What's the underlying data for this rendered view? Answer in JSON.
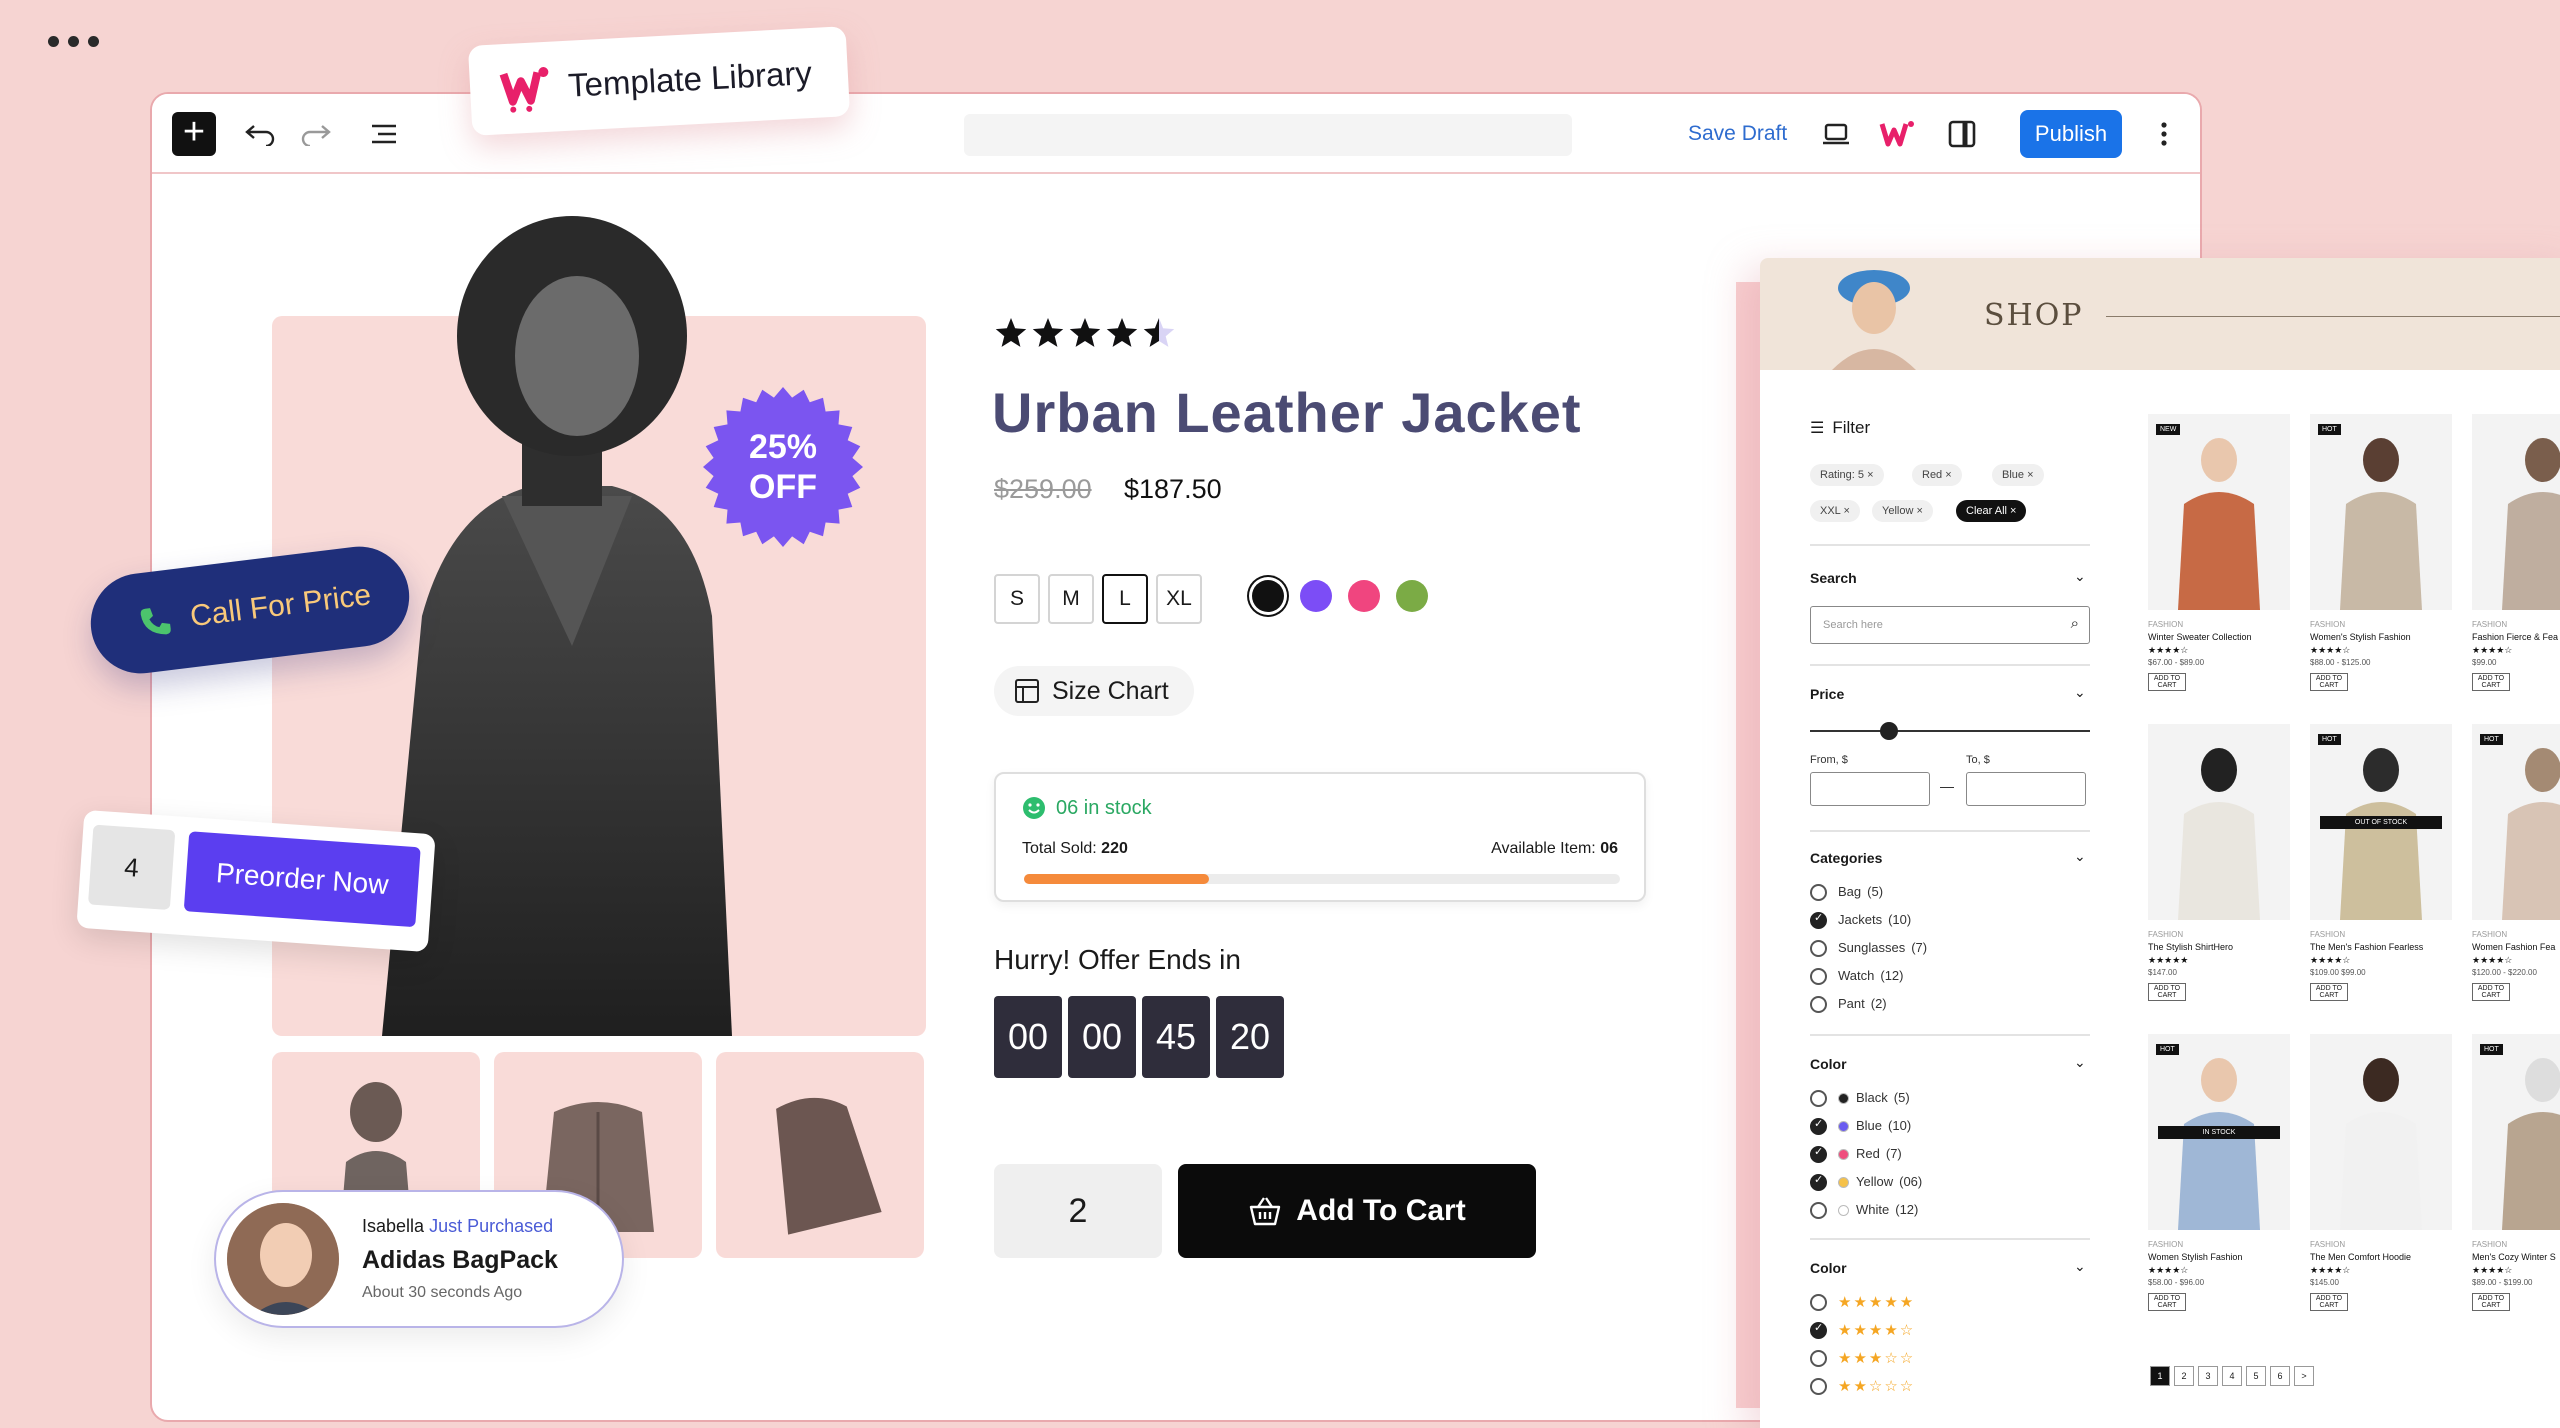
{
  "toolbar": {
    "save_draft": "Save Draft",
    "publish": "Publish"
  },
  "template_library": {
    "label": "Template Library"
  },
  "product": {
    "badge_pct": "25%",
    "badge_off": "OFF",
    "rating": 4.5,
    "title": "Urban Leather Jacket",
    "old_price": "$259.00",
    "price": "$187.50",
    "sizes": [
      "S",
      "M",
      "L",
      "XL"
    ],
    "selected_size": "L",
    "colors": [
      "#111111",
      "#7c4df6",
      "#f0457f",
      "#7bab45"
    ],
    "size_chart": "Size Chart",
    "stock_text": "06 in stock",
    "total_sold_label": "Total Sold:",
    "total_sold": "220",
    "available_label": "Available Item:",
    "available": "06",
    "stock_progress": 0.31,
    "hurry": "Hurry! Offer Ends in",
    "countdown": [
      "00",
      "00",
      "45",
      "20"
    ],
    "quantity": "2",
    "add_to_cart": "Add To Cart"
  },
  "call_for_price": "Call For Price",
  "preorder": {
    "qty": "4",
    "label": "Preorder Now"
  },
  "notification": {
    "name": "Isabella",
    "action": "Just Purchased",
    "product": "Adidas BagPack",
    "time": "About 30 seconds Ago"
  },
  "shop": {
    "title": "SHOP",
    "filter": "Filter",
    "chips": [
      "Rating: 5",
      "Red",
      "Blue",
      "XXL",
      "Yellow",
      "Clear All"
    ],
    "search_title": "Search",
    "search_placeholder": "Search here",
    "price_title": "Price",
    "from_label": "From, $",
    "to_label": "To, $",
    "categories_title": "Categories",
    "categories": [
      {
        "label": "Bag",
        "count": "(5)",
        "checked": false
      },
      {
        "label": "Jackets",
        "count": "(10)",
        "checked": true
      },
      {
        "label": "Sunglasses",
        "count": "(7)",
        "checked": false
      },
      {
        "label": "Watch",
        "count": "(12)",
        "checked": false
      },
      {
        "label": "Pant",
        "count": "(2)",
        "checked": false
      }
    ],
    "color_title": "Color",
    "colors": [
      {
        "label": "Black",
        "count": "(5)",
        "checked": false,
        "swatch": "#222222"
      },
      {
        "label": "Blue",
        "count": "(10)",
        "checked": true,
        "swatch": "#6a5cf0"
      },
      {
        "label": "Red",
        "count": "(7)",
        "checked": true,
        "swatch": "#ef4f7e"
      },
      {
        "label": "Yellow",
        "count": "(06)",
        "checked": true,
        "swatch": "#f5c149"
      },
      {
        "label": "White",
        "count": "(12)",
        "checked": false,
        "swatch": "#ffffff"
      }
    ],
    "rating_title": "Color",
    "ratings": [
      {
        "stars": 5,
        "checked": false
      },
      {
        "stars": 4,
        "checked": true
      },
      {
        "stars": 3,
        "checked": false
      },
      {
        "stars": 2,
        "checked": false
      }
    ],
    "products": [
      {
        "tag": "NEW",
        "cat": "FASHION",
        "name": "Winter Sweater Collection",
        "stars": "★★★★☆",
        "price": "$67.00 - $89.00",
        "btn": "ADD TO CART"
      },
      {
        "tag": "HOT",
        "cat": "FASHION",
        "name": "Women's Stylish Fashion",
        "stars": "★★★★☆",
        "price": "$88.00 - $125.00",
        "btn": "ADD TO CART"
      },
      {
        "tag": "",
        "cat": "FASHION",
        "name": "Fashion Fierce & Fea",
        "stars": "★★★★☆",
        "price": "$99.00",
        "btn": "ADD TO CART"
      },
      {
        "tag": "",
        "cat": "FASHION",
        "name": "The Stylish ShirtHero",
        "stars": "★★★★★",
        "price": "$147.00",
        "btn": "ADD TO CART"
      },
      {
        "tag": "HOT",
        "cat": "FASHION",
        "name": "The Men's Fashion Fearless",
        "stars": "★★★★☆",
        "price": "$109.00 $99.00",
        "btn": "ADD TO CART",
        "overlay": "OUT OF STOCK"
      },
      {
        "tag": "HOT",
        "cat": "FASHION",
        "name": "Women Fashion Fea",
        "stars": "★★★★☆",
        "price": "$120.00 - $220.00",
        "btn": "ADD TO CART"
      },
      {
        "tag": "HOT",
        "cat": "FASHION",
        "name": "Women Stylish Fashion",
        "stars": "★★★★☆",
        "price": "$58.00 - $96.00",
        "btn": "ADD TO CART",
        "overlay": "IN STOCK"
      },
      {
        "tag": "",
        "cat": "FASHION",
        "name": "The Men Comfort Hoodie",
        "stars": "★★★★☆",
        "price": "$145.00",
        "btn": "ADD TO CART"
      },
      {
        "tag": "HOT",
        "cat": "FASHION",
        "name": "Men's Cozy Winter S",
        "stars": "★★★★☆",
        "price": "$89.00 - $199.00",
        "btn": "ADD TO CART"
      }
    ],
    "pages": [
      "1",
      "2",
      "3",
      "4",
      "5",
      "6",
      ">"
    ]
  }
}
